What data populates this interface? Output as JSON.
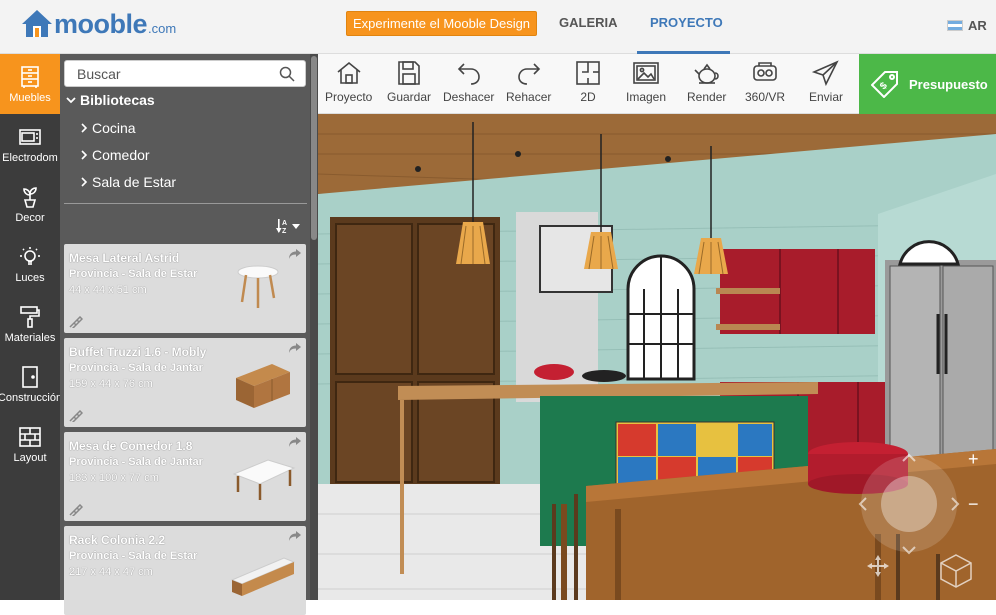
{
  "app": {
    "logo_name": "mooble",
    "logo_suffix": ".com",
    "promo_button": "Experimente el Mooble Design",
    "nav": [
      {
        "label": "GALERIA"
      },
      {
        "label": "PROYECTO",
        "active": true
      }
    ],
    "country_code": "AR",
    "accent_color": "#3e78b8",
    "promo_color": "#f7941d"
  },
  "rail": {
    "items": [
      {
        "label": "Muebles",
        "icon": "dresser-icon",
        "active": true
      },
      {
        "label": "Electrodom",
        "icon": "microwave-icon"
      },
      {
        "label": "Decor",
        "icon": "plant-icon"
      },
      {
        "label": "Luces",
        "icon": "lightbulb-icon"
      },
      {
        "label": "Materiales",
        "icon": "paint-roller-icon"
      },
      {
        "label": "Construcción",
        "icon": "door-icon"
      },
      {
        "label": "Layout",
        "icon": "brick-wall-icon"
      }
    ]
  },
  "library": {
    "search_placeholder": "Buscar",
    "root_label": "Bibliotecas",
    "children": [
      "Cocina",
      "Comedor",
      "Sala de Estar"
    ],
    "items": [
      {
        "title": "Mesa Lateral Astrid",
        "subtitle": "Provincia - Sala de Estar",
        "dimensions": "44 x 44 x 51 cm"
      },
      {
        "title": "Buffet Truzzi 1.6 - Mobly",
        "subtitle": "Provincia - Sala de Jantar",
        "dimensions": "159 x 44 x 76 cm"
      },
      {
        "title": "Mesa de Comedor 1.8",
        "subtitle": "Provincia - Sala de Jantar",
        "dimensions": "183 x 100 x 77 cm"
      },
      {
        "title": "Rack Colonia 2.2",
        "subtitle": "Provincia - Sala de Estar",
        "dimensions": "217 x 44 x 47 cm"
      }
    ]
  },
  "toolbar": {
    "tools": [
      {
        "label": "Proyecto",
        "icon": "house-icon"
      },
      {
        "label": "Guardar",
        "icon": "floppy-disk-icon"
      },
      {
        "label": "Deshacer",
        "icon": "undo-icon"
      },
      {
        "label": "Rehacer",
        "icon": "redo-icon"
      },
      {
        "label": "2D",
        "icon": "floorplan-icon"
      },
      {
        "label": "Imagen",
        "icon": "image-icon"
      },
      {
        "label": "Render",
        "icon": "teapot-icon"
      },
      {
        "label": "360/VR",
        "icon": "vr-headset-icon"
      },
      {
        "label": "Enviar",
        "icon": "paper-plane-icon"
      }
    ],
    "budget_label": "Presupuesto",
    "budget_color": "#4cb848"
  },
  "viewport": {
    "zoom_in": "+",
    "zoom_out": "−"
  }
}
